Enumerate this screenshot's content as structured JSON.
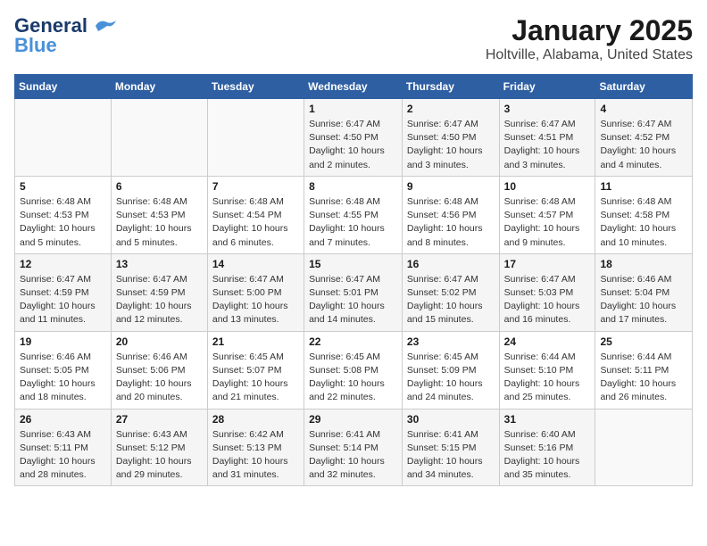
{
  "header": {
    "logo_line1": "General",
    "logo_line2": "Blue",
    "title": "January 2025",
    "subtitle": "Holtville, Alabama, United States"
  },
  "days_of_week": [
    "Sunday",
    "Monday",
    "Tuesday",
    "Wednesday",
    "Thursday",
    "Friday",
    "Saturday"
  ],
  "weeks": [
    [
      {
        "day": "",
        "info": ""
      },
      {
        "day": "",
        "info": ""
      },
      {
        "day": "",
        "info": ""
      },
      {
        "day": "1",
        "info": "Sunrise: 6:47 AM\nSunset: 4:50 PM\nDaylight: 10 hours\nand 2 minutes."
      },
      {
        "day": "2",
        "info": "Sunrise: 6:47 AM\nSunset: 4:50 PM\nDaylight: 10 hours\nand 3 minutes."
      },
      {
        "day": "3",
        "info": "Sunrise: 6:47 AM\nSunset: 4:51 PM\nDaylight: 10 hours\nand 3 minutes."
      },
      {
        "day": "4",
        "info": "Sunrise: 6:47 AM\nSunset: 4:52 PM\nDaylight: 10 hours\nand 4 minutes."
      }
    ],
    [
      {
        "day": "5",
        "info": "Sunrise: 6:48 AM\nSunset: 4:53 PM\nDaylight: 10 hours\nand 5 minutes."
      },
      {
        "day": "6",
        "info": "Sunrise: 6:48 AM\nSunset: 4:53 PM\nDaylight: 10 hours\nand 5 minutes."
      },
      {
        "day": "7",
        "info": "Sunrise: 6:48 AM\nSunset: 4:54 PM\nDaylight: 10 hours\nand 6 minutes."
      },
      {
        "day": "8",
        "info": "Sunrise: 6:48 AM\nSunset: 4:55 PM\nDaylight: 10 hours\nand 7 minutes."
      },
      {
        "day": "9",
        "info": "Sunrise: 6:48 AM\nSunset: 4:56 PM\nDaylight: 10 hours\nand 8 minutes."
      },
      {
        "day": "10",
        "info": "Sunrise: 6:48 AM\nSunset: 4:57 PM\nDaylight: 10 hours\nand 9 minutes."
      },
      {
        "day": "11",
        "info": "Sunrise: 6:48 AM\nSunset: 4:58 PM\nDaylight: 10 hours\nand 10 minutes."
      }
    ],
    [
      {
        "day": "12",
        "info": "Sunrise: 6:47 AM\nSunset: 4:59 PM\nDaylight: 10 hours\nand 11 minutes."
      },
      {
        "day": "13",
        "info": "Sunrise: 6:47 AM\nSunset: 4:59 PM\nDaylight: 10 hours\nand 12 minutes."
      },
      {
        "day": "14",
        "info": "Sunrise: 6:47 AM\nSunset: 5:00 PM\nDaylight: 10 hours\nand 13 minutes."
      },
      {
        "day": "15",
        "info": "Sunrise: 6:47 AM\nSunset: 5:01 PM\nDaylight: 10 hours\nand 14 minutes."
      },
      {
        "day": "16",
        "info": "Sunrise: 6:47 AM\nSunset: 5:02 PM\nDaylight: 10 hours\nand 15 minutes."
      },
      {
        "day": "17",
        "info": "Sunrise: 6:47 AM\nSunset: 5:03 PM\nDaylight: 10 hours\nand 16 minutes."
      },
      {
        "day": "18",
        "info": "Sunrise: 6:46 AM\nSunset: 5:04 PM\nDaylight: 10 hours\nand 17 minutes."
      }
    ],
    [
      {
        "day": "19",
        "info": "Sunrise: 6:46 AM\nSunset: 5:05 PM\nDaylight: 10 hours\nand 18 minutes."
      },
      {
        "day": "20",
        "info": "Sunrise: 6:46 AM\nSunset: 5:06 PM\nDaylight: 10 hours\nand 20 minutes."
      },
      {
        "day": "21",
        "info": "Sunrise: 6:45 AM\nSunset: 5:07 PM\nDaylight: 10 hours\nand 21 minutes."
      },
      {
        "day": "22",
        "info": "Sunrise: 6:45 AM\nSunset: 5:08 PM\nDaylight: 10 hours\nand 22 minutes."
      },
      {
        "day": "23",
        "info": "Sunrise: 6:45 AM\nSunset: 5:09 PM\nDaylight: 10 hours\nand 24 minutes."
      },
      {
        "day": "24",
        "info": "Sunrise: 6:44 AM\nSunset: 5:10 PM\nDaylight: 10 hours\nand 25 minutes."
      },
      {
        "day": "25",
        "info": "Sunrise: 6:44 AM\nSunset: 5:11 PM\nDaylight: 10 hours\nand 26 minutes."
      }
    ],
    [
      {
        "day": "26",
        "info": "Sunrise: 6:43 AM\nSunset: 5:11 PM\nDaylight: 10 hours\nand 28 minutes."
      },
      {
        "day": "27",
        "info": "Sunrise: 6:43 AM\nSunset: 5:12 PM\nDaylight: 10 hours\nand 29 minutes."
      },
      {
        "day": "28",
        "info": "Sunrise: 6:42 AM\nSunset: 5:13 PM\nDaylight: 10 hours\nand 31 minutes."
      },
      {
        "day": "29",
        "info": "Sunrise: 6:41 AM\nSunset: 5:14 PM\nDaylight: 10 hours\nand 32 minutes."
      },
      {
        "day": "30",
        "info": "Sunrise: 6:41 AM\nSunset: 5:15 PM\nDaylight: 10 hours\nand 34 minutes."
      },
      {
        "day": "31",
        "info": "Sunrise: 6:40 AM\nSunset: 5:16 PM\nDaylight: 10 hours\nand 35 minutes."
      },
      {
        "day": "",
        "info": ""
      }
    ]
  ]
}
